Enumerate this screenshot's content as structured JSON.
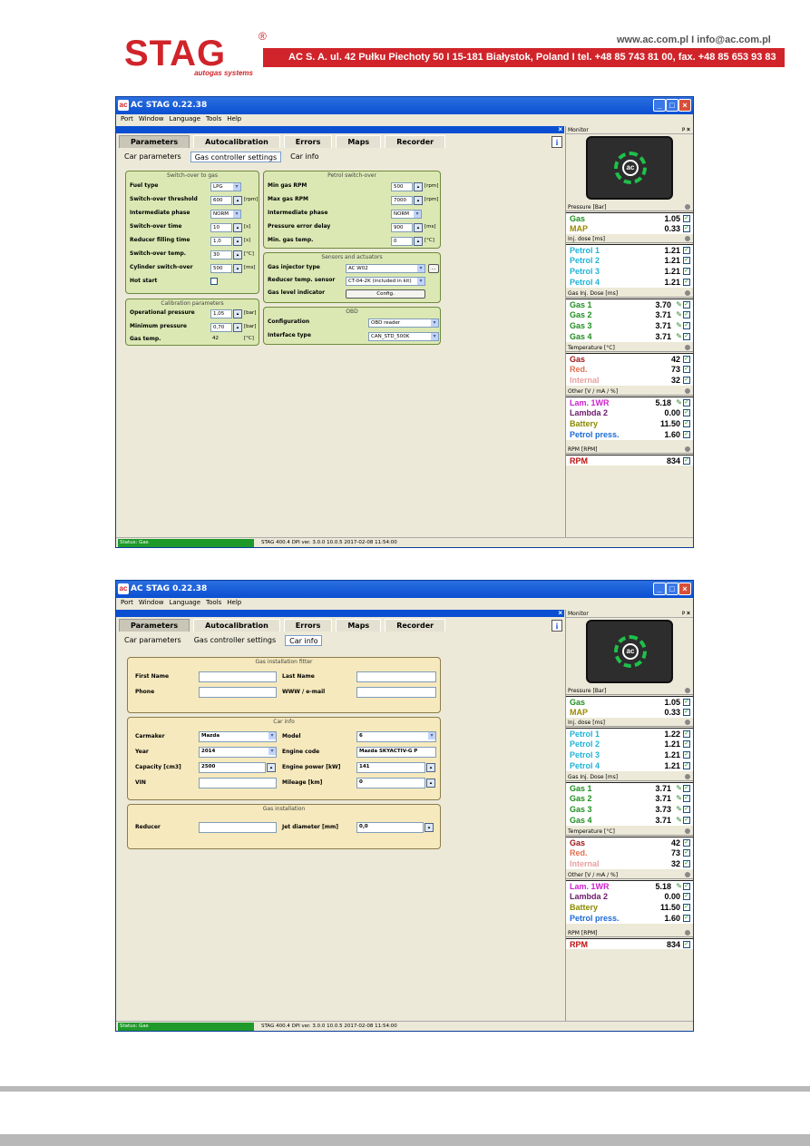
{
  "header": {
    "logo": "STAG",
    "logo_sub": "autogas systems",
    "reg": "®",
    "site": "www.ac.com.pl I info@ac.com.pl",
    "address": "AC S. A. ul. 42 Pułku Piechoty 50 I 15-181 Białystok, Poland I tel. +48 85 743 81 00, fax. +48 85 653 93 83"
  },
  "app": {
    "title": "AC STAG 0.22.38",
    "menu": [
      "Port",
      "Window",
      "Language",
      "Tools",
      "Help"
    ],
    "main_tabs": [
      "Parameters",
      "Autocalibration",
      "Errors",
      "Maps",
      "Recorder"
    ],
    "sub_tabs": [
      "Car parameters",
      "Gas controller settings",
      "Car info"
    ],
    "status_left": "Status: Gas",
    "status_right": "STAG 400.4 DPI  ver. 3.0.0  10.0.5  2017-02-08 11:54:00"
  },
  "w1": {
    "switchover": {
      "title": "Switch-over to gas",
      "fuel_type": "Fuel type",
      "fuel_val": "LPG",
      "threshold": "Switch-over threshold",
      "threshold_val": "600",
      "rpm": "[rpm]",
      "inter": "Intermediate phase",
      "inter_val": "NORM",
      "time": "Switch-over time",
      "time_val": "10",
      "s": "[s]",
      "refill": "Reducer filling time",
      "refill_val": "1,0",
      "temp": "Switch-over temp.",
      "temp_val": "30",
      "c": "[°C]",
      "cyl": "Cylinder switch-over",
      "cyl_val": "500",
      "ms": "[ms]",
      "hot": "Hot start"
    },
    "calib": {
      "title": "Calibration parameters",
      "op": "Operational pressure",
      "op_val": "1,05",
      "bar": "[bar]",
      "min": "Minimum pressure",
      "min_val": "0,70",
      "gtemp": "Gas temp.",
      "gtemp_val": "42",
      "c": "[°C]"
    },
    "petrol": {
      "title": "Petrol switch-over",
      "min_rpm": "Min gas RPM",
      "min_rpm_val": "500",
      "rpm": "[rpm]",
      "max_rpm": "Max gas RPM",
      "max_rpm_val": "7000",
      "inter": "Intermediate phase",
      "inter_val": "NORM",
      "perr": "Pressure error delay",
      "perr_val": "900",
      "ms": "[ms]",
      "mint": "Min. gas temp.",
      "mint_val": "0",
      "c": "[°C]"
    },
    "sensors": {
      "title": "Sensors and actuators",
      "inj": "Gas injector type",
      "inj_val": "AC W02",
      "dots": "...",
      "red": "Reducer temp. sensor",
      "red_val": "CT-04-2K (included in kit)",
      "lvl": "Gas level indicator",
      "cfg": "Config."
    },
    "obd": {
      "title": "OBD",
      "conf": "Configuration",
      "conf_val": "OBD reader",
      "iface": "Interface type",
      "iface_val": "CAN_STD_500K"
    }
  },
  "w2": {
    "installer": {
      "title": "Gas installation fitter",
      "first": "First Name",
      "last": "Last Name",
      "phone": "Phone",
      "www": "WWW / e-mail"
    },
    "car": {
      "title": "Car info",
      "maker": "Carmaker",
      "maker_val": "Mazda",
      "model": "Model",
      "model_val": "6",
      "year": "Year",
      "year_val": "2014",
      "code": "Engine code",
      "code_val": "Mazda SKYACTIV-G P",
      "cap": "Capacity [cm3]",
      "cap_val": "2500",
      "power": "Engine power [kW]",
      "power_val": "141",
      "vin": "VIN",
      "mil": "Mileage [km]",
      "mil_val": "0"
    },
    "inst": {
      "title": "Gas installation",
      "reducer": "Reducer",
      "jet": "Jet diameter [mm]",
      "jet_val": "0,0"
    }
  },
  "monitor": {
    "title": "Monitor",
    "sections": {
      "pressure": "Pressure [Bar]",
      "inj": "Inj. dose [ms]",
      "gasinj": "Gas Inj. Dose [ms]",
      "temp": "Temperature [°C]",
      "other": "Other [V / mA / %]",
      "rpm": "RPM [RPM]"
    },
    "labels": {
      "gas": "Gas",
      "map": "MAP",
      "p1": "Petrol 1",
      "p2": "Petrol 2",
      "p3": "Petrol 3",
      "p4": "Petrol 4",
      "g1": "Gas 1",
      "g2": "Gas 2",
      "g3": "Gas 3",
      "g4": "Gas 4",
      "tgas": "Gas",
      "red": "Red.",
      "internal": "Internal",
      "lam": "Lam. 1WR",
      "lam2": "Lambda 2",
      "bat": "Battery",
      "pp": "Petrol press.",
      "rpm": "RPM"
    },
    "m1": {
      "gas": "1.05",
      "map": "0.33",
      "p1": "1.21",
      "p2": "1.21",
      "p3": "1.21",
      "p4": "1.21",
      "g1": "3.70",
      "g2": "3.71",
      "g3": "3.71",
      "g4": "3.71",
      "tgas": "42",
      "red": "73",
      "internal": "32",
      "lam": "5.18",
      "lam2": "0.00",
      "bat": "11.50",
      "pp": "1.60",
      "rpm": "834"
    },
    "m2": {
      "gas": "1.05",
      "map": "0.33",
      "p1": "1.22",
      "p2": "1.21",
      "p3": "1.21",
      "p4": "1.21",
      "g1": "3.71",
      "g2": "3.71",
      "g3": "3.73",
      "g4": "3.71",
      "tgas": "42",
      "red": "73",
      "internal": "32",
      "lam": "5.18",
      "lam2": "0.00",
      "bat": "11.50",
      "pp": "1.60",
      "rpm": "834"
    },
    "colors": {
      "gas": "#1f8f1f",
      "map": "#9a8a00",
      "petrol": "#1fb3d8",
      "temp": "#a01818",
      "red": "#e07050",
      "internal": "#e8a0a0",
      "lam": "#d01fd0",
      "lam2": "#6a1a6a",
      "bat": "#8a8a00",
      "pp": "#1a6ad8",
      "rpm": "#c01010"
    }
  }
}
